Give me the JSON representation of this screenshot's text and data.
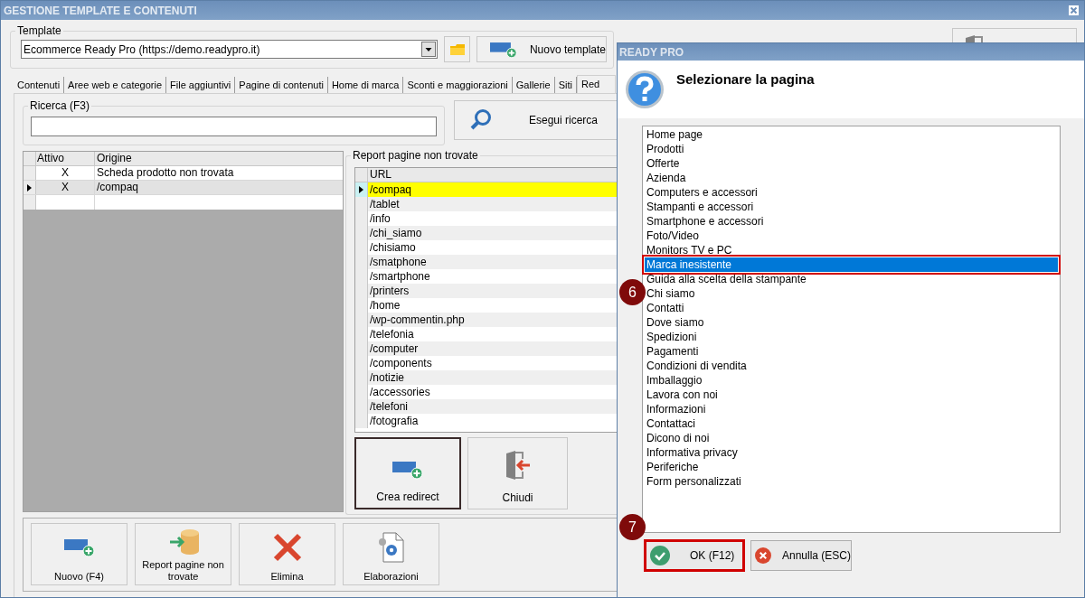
{
  "main_window": {
    "title": "GESTIONE TEMPLATE E CONTENUTI"
  },
  "template": {
    "label": "Template",
    "value": "Ecommerce Ready Pro (https://demo.readypro.it)",
    "new_button": "Nuovo template"
  },
  "tabs": [
    {
      "label": "Contenuti",
      "selected": false
    },
    {
      "label": "Aree web e categorie",
      "selected": false
    },
    {
      "label": "File aggiuntivi",
      "selected": false
    },
    {
      "label": "Pagine di contenuti",
      "selected": false
    },
    {
      "label": "Home di marca",
      "selected": false
    },
    {
      "label": "Sconti e maggiorazioni",
      "selected": false
    },
    {
      "label": "Gallerie",
      "selected": false
    },
    {
      "label": "Siti",
      "selected": false
    },
    {
      "label": "Red",
      "selected": true
    }
  ],
  "search": {
    "label": "Ricerca (F3)",
    "button": "Esegui ricerca"
  },
  "redirects": {
    "columns": [
      "Attivo",
      "Origine"
    ],
    "rows": [
      {
        "attivo": "X",
        "origine": "Scheda prodotto non trovata",
        "selected": false
      },
      {
        "attivo": "X",
        "origine": "/compaq",
        "selected": true
      }
    ]
  },
  "report": {
    "title": "Report pagine non trovate",
    "column": "URL",
    "rows": [
      {
        "url": "/compaq",
        "selected": true
      },
      {
        "url": "/tablet",
        "selected": false
      },
      {
        "url": "/info",
        "selected": false
      },
      {
        "url": "/chi_siamo",
        "selected": false
      },
      {
        "url": "/chisiamo",
        "selected": false
      },
      {
        "url": "/smatphone",
        "selected": false
      },
      {
        "url": "/smartphone",
        "selected": false
      },
      {
        "url": "/printers",
        "selected": false
      },
      {
        "url": "/home",
        "selected": false
      },
      {
        "url": "/wp-commentin.php",
        "selected": false
      },
      {
        "url": "/telefonia",
        "selected": false
      },
      {
        "url": "/computer",
        "selected": false
      },
      {
        "url": "/components",
        "selected": false
      },
      {
        "url": "/notizie",
        "selected": false
      },
      {
        "url": "/accessories",
        "selected": false
      },
      {
        "url": "/telefoni",
        "selected": false
      },
      {
        "url": "/fotografia",
        "selected": false
      }
    ],
    "buttons": [
      {
        "label": "Crea redirect",
        "kind": "create",
        "focused": true
      },
      {
        "label": "Chiudi",
        "kind": "close",
        "focused": false
      }
    ]
  },
  "toolbar": [
    {
      "label": "Nuovo (F4)",
      "kind": "create"
    },
    {
      "label": "Report pagine non trovate",
      "kind": "report"
    },
    {
      "label": "Elimina",
      "kind": "delete"
    },
    {
      "label": "Elaborazioni",
      "kind": "process"
    }
  ],
  "dialog": {
    "title": "READY PRO",
    "prompt": "Selezionare la pagina",
    "pages": [
      {
        "label": "Home page",
        "selected": false
      },
      {
        "label": "Prodotti",
        "selected": false
      },
      {
        "label": "Offerte",
        "selected": false
      },
      {
        "label": "Azienda",
        "selected": false
      },
      {
        "label": "Computers e accessori",
        "selected": false
      },
      {
        "label": "Stampanti e accessori",
        "selected": false
      },
      {
        "label": "Smartphone e accessori",
        "selected": false
      },
      {
        "label": "Foto/Video",
        "selected": false
      },
      {
        "label": "Monitors TV e PC",
        "selected": false
      },
      {
        "label": "Marca inesistente",
        "selected": true
      },
      {
        "label": "Guida alla scelta della stampante",
        "selected": false
      },
      {
        "label": "Chi siamo",
        "selected": false
      },
      {
        "label": "Contatti",
        "selected": false
      },
      {
        "label": "Dove siamo",
        "selected": false
      },
      {
        "label": "Spedizioni",
        "selected": false
      },
      {
        "label": "Pagamenti",
        "selected": false
      },
      {
        "label": "Condizioni di vendita",
        "selected": false
      },
      {
        "label": "Imballaggio",
        "selected": false
      },
      {
        "label": "Lavora con noi",
        "selected": false
      },
      {
        "label": "Informazioni",
        "selected": false
      },
      {
        "label": "Contattaci",
        "selected": false
      },
      {
        "label": "Dicono di noi",
        "selected": false
      },
      {
        "label": "Informativa privacy",
        "selected": false
      },
      {
        "label": "Periferiche",
        "selected": false
      },
      {
        "label": "Form personalizzati",
        "selected": false
      }
    ],
    "ok": {
      "label": "OK (F12)",
      "highlighted": true
    },
    "cancel": {
      "label": "Annulla (ESC)"
    },
    "step_markers": [
      "6",
      "7"
    ]
  }
}
